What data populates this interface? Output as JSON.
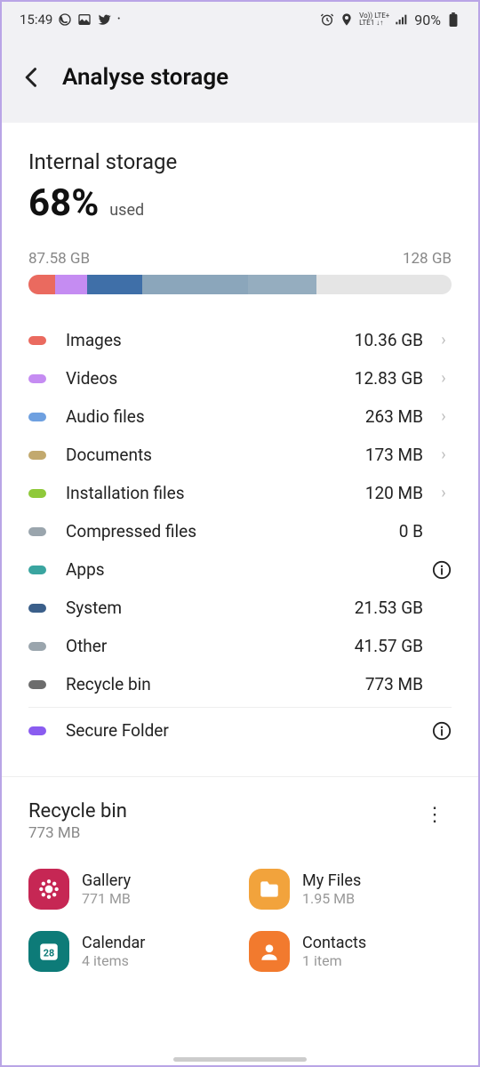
{
  "status": {
    "time": "15:49",
    "battery": "90%"
  },
  "header": {
    "title": "Analyse storage"
  },
  "storage": {
    "title": "Internal storage",
    "percent": "68%",
    "percent_label": "used",
    "used_label": "87.58 GB",
    "total_label": "128 GB",
    "segments": [
      {
        "color": "#ea6a5f",
        "width": 6.2
      },
      {
        "color": "#c58cf2",
        "width": 7.7
      },
      {
        "color": "#3f6fa8",
        "width": 12.9
      },
      {
        "color": "#8ba6bb",
        "width": 25.0
      },
      {
        "color": "#95adbf",
        "width": 16.2
      }
    ],
    "categories": [
      {
        "color": "#ea6a5f",
        "label": "Images",
        "value": "10.36 GB",
        "chevron": true
      },
      {
        "color": "#c58cf2",
        "label": "Videos",
        "value": "12.83 GB",
        "chevron": true
      },
      {
        "color": "#6ea0e0",
        "label": "Audio files",
        "value": "263 MB",
        "chevron": true
      },
      {
        "color": "#c2a96e",
        "label": "Documents",
        "value": "173 MB",
        "chevron": true
      },
      {
        "color": "#8fc93a",
        "label": "Installation files",
        "value": "120 MB",
        "chevron": true
      },
      {
        "color": "#9aa5ad",
        "label": "Compressed files",
        "value": "0 B",
        "chevron": false
      },
      {
        "color": "#3aa5a0",
        "label": "Apps",
        "value": "",
        "info": true
      },
      {
        "color": "#3b5f8a",
        "label": "System",
        "value": "21.53 GB",
        "chevron": false
      },
      {
        "color": "#9aa5ad",
        "label": "Other",
        "value": "41.57 GB",
        "chevron": false
      },
      {
        "color": "#6c6c6c",
        "label": "Recycle bin",
        "value": "773 MB",
        "chevron": false
      },
      {
        "color": "#8a5cf0",
        "label": "Secure Folder",
        "value": "",
        "info": true,
        "divider": true
      }
    ]
  },
  "recycle": {
    "title": "Recycle bin",
    "sub": "773 MB",
    "apps": [
      {
        "icon": "gallery",
        "bg": "#c62754",
        "label": "Gallery",
        "sub": "771 MB"
      },
      {
        "icon": "folder",
        "bg": "#f2a33c",
        "label": "My Files",
        "sub": "1.95 MB"
      },
      {
        "icon": "calendar",
        "bg": "#0d7b78",
        "label": "Calendar",
        "sub": "4 items"
      },
      {
        "icon": "contact",
        "bg": "#f27a2e",
        "label": "Contacts",
        "sub": "1 item"
      }
    ]
  }
}
